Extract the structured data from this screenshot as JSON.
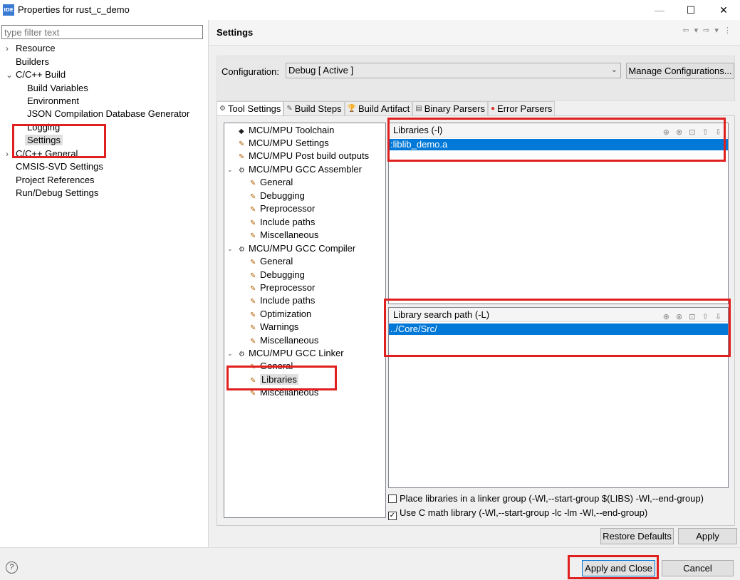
{
  "window": {
    "app_icon_text": "IDE",
    "title": "Properties for rust_c_demo",
    "minimize": "—",
    "maximize": "☐",
    "close": "✕"
  },
  "left": {
    "filter_placeholder": "type filter text",
    "items": [
      {
        "label": "Resource",
        "arrow": "›"
      },
      {
        "label": "Builders"
      },
      {
        "label": "C/C++ Build",
        "arrow": "⌄"
      },
      {
        "label": "Build Variables"
      },
      {
        "label": "Environment"
      },
      {
        "label": "JSON Compilation Database Generator"
      },
      {
        "label": "Logging"
      },
      {
        "label": "Settings"
      },
      {
        "label": "C/C++ General",
        "arrow": "›"
      },
      {
        "label": "CMSIS-SVD Settings"
      },
      {
        "label": "Project References"
      },
      {
        "label": "Run/Debug Settings"
      }
    ]
  },
  "settings": {
    "title": "Settings",
    "nav_icons": "⇦ ▾ ⇨ ▾ ⋮",
    "config_label": "Configuration:",
    "config_value": "Debug  [ Active ]",
    "manage_label": "Manage Configurations..."
  },
  "tabs": [
    {
      "label": "Tool Settings",
      "icon": "⚙"
    },
    {
      "label": "Build Steps",
      "icon": "✎"
    },
    {
      "label": "Build Artifact",
      "icon": "🏆"
    },
    {
      "label": "Binary Parsers",
      "icon": "▤"
    },
    {
      "label": "Error Parsers",
      "icon": "●"
    }
  ],
  "tool_tree": [
    {
      "label": "MCU/MPU Toolchain"
    },
    {
      "label": "MCU/MPU Settings"
    },
    {
      "label": "MCU/MPU Post build outputs"
    },
    {
      "label": "MCU/MPU GCC Assembler"
    },
    {
      "label": "General"
    },
    {
      "label": "Debugging"
    },
    {
      "label": "Preprocessor"
    },
    {
      "label": "Include paths"
    },
    {
      "label": "Miscellaneous"
    },
    {
      "label": "MCU/MPU GCC Compiler"
    },
    {
      "label": "General"
    },
    {
      "label": "Debugging"
    },
    {
      "label": "Preprocessor"
    },
    {
      "label": "Include paths"
    },
    {
      "label": "Optimization"
    },
    {
      "label": "Warnings"
    },
    {
      "label": "Miscellaneous"
    },
    {
      "label": "MCU/MPU GCC Linker"
    },
    {
      "label": "General"
    },
    {
      "label": "Libraries"
    },
    {
      "label": "Miscellaneous"
    }
  ],
  "libraries": {
    "header": "Libraries (-l)",
    "icons": "⊕ ⊗ ⊡ ⇧ ⇩",
    "items": [
      ":liblib_demo.a"
    ]
  },
  "lib_search": {
    "header": "Library search path (-L)",
    "icons": "⊕ ⊗ ⊡ ⇧ ⇩",
    "items": [
      "../Core/Src/"
    ]
  },
  "options": {
    "linker_group": "Place libraries in a linker group (-Wl,--start-group $(LIBS) -Wl,--end-group)",
    "linker_group_checked": false,
    "c_math": "Use C math library (-Wl,--start-group -lc -lm -Wl,--end-group)",
    "c_math_checked": true
  },
  "buttons": {
    "restore_defaults": "Restore Defaults",
    "apply": "Apply",
    "apply_close": "Apply and Close",
    "cancel": "Cancel",
    "help": "?"
  },
  "annotation_color": "#e0201e",
  "selection_color": "#0078d7"
}
